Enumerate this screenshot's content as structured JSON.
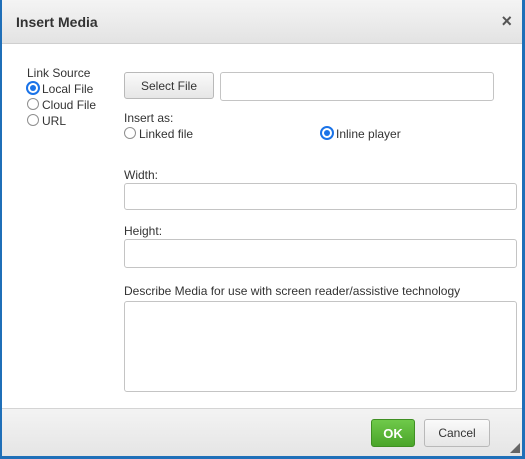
{
  "dialog": {
    "title": "Insert Media",
    "close_glyph": "×"
  },
  "link_source": {
    "heading": "Link Source",
    "options": [
      {
        "label": "Local File",
        "selected": true
      },
      {
        "label": "Cloud File",
        "selected": false
      },
      {
        "label": "URL",
        "selected": false
      }
    ]
  },
  "select_file": {
    "button_label": "Select File",
    "value": ""
  },
  "insert_as": {
    "heading": "Insert as:",
    "options": [
      {
        "label": "Linked file",
        "selected": false
      },
      {
        "label": "Inline player",
        "selected": true
      }
    ]
  },
  "width": {
    "label": "Width:",
    "value": ""
  },
  "height": {
    "label": "Height:",
    "value": ""
  },
  "description": {
    "label": "Describe Media for use with screen reader/assistive technology",
    "value": ""
  },
  "footer": {
    "ok_label": "OK",
    "cancel_label": "Cancel"
  },
  "colors": {
    "accent": "#1f6fb8",
    "radio_selected": "#1a73e8",
    "ok_green": "#4aa52a"
  },
  "icons": {
    "close": "close-icon",
    "resize": "resize-grip-icon"
  }
}
